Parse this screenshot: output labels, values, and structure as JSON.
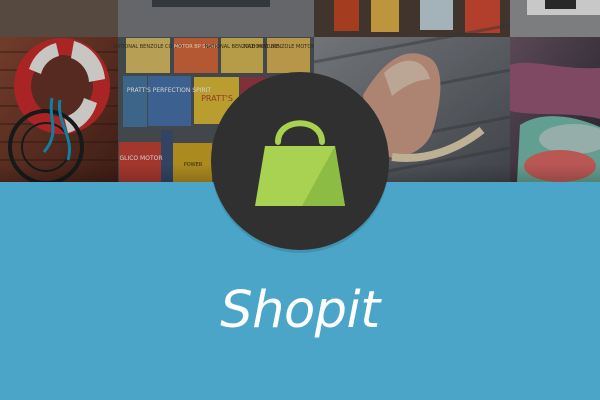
{
  "app": {
    "title": "Shopit"
  },
  "icons": {
    "logo": "shopping-bag-icon"
  },
  "colors": {
    "background": "#4ba5c8",
    "badge": "#2f302f",
    "bag_light": "#a9d253",
    "bag_dark": "#8dbd44",
    "title": "#ffffff"
  },
  "hero": {
    "labels": [
      "NATIONAL BENZOLE CO LTD",
      "MOTOR BP SPIRIT",
      "NATIONAL BENZOLE MIXTURE",
      "NATIONAL BENZOLE MOTOR SPIRIT",
      "PRATT'S PERFECTION SPIRIT",
      "PRATT'S",
      "GLICO MOTOR",
      "POWER"
    ]
  }
}
